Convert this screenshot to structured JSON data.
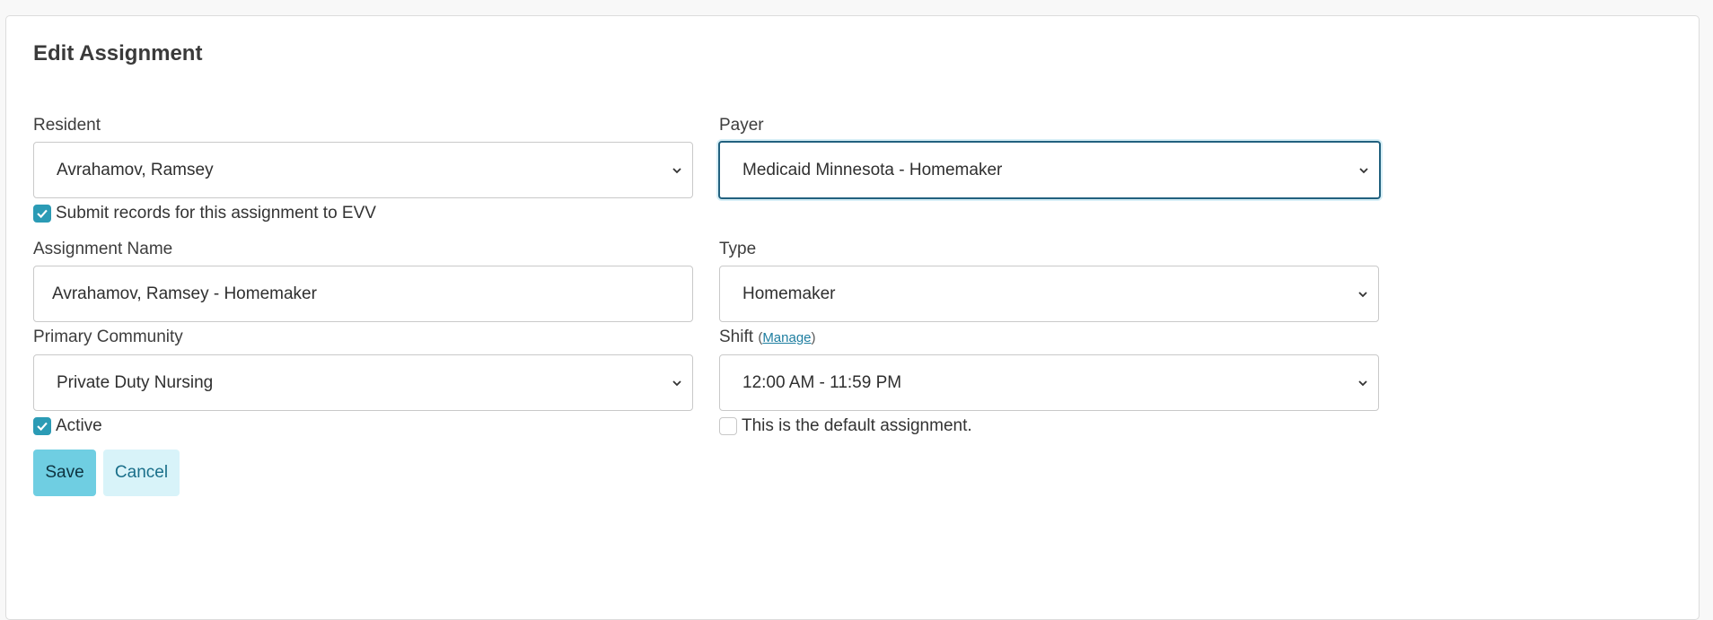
{
  "form": {
    "title": "Edit Assignment",
    "resident": {
      "label": "Resident",
      "value": "Avrahamov, Ramsey"
    },
    "payer": {
      "label": "Payer",
      "value": "Medicaid Minnesota - Homemaker"
    },
    "evv_checkbox": {
      "label": "Submit records for this assignment to EVV",
      "checked": true
    },
    "assignment_name": {
      "label": "Assignment Name",
      "value": "Avrahamov, Ramsey - Homemaker"
    },
    "type": {
      "label": "Type",
      "value": "Homemaker"
    },
    "primary_community": {
      "label": "Primary Community",
      "value": "Private Duty Nursing"
    },
    "shift": {
      "label": "Shift",
      "paren_open": "(",
      "manage_link": "Manage",
      "paren_close": ")",
      "value": "12:00 AM - 11:59 PM"
    },
    "active_checkbox": {
      "label": "Active",
      "checked": true
    },
    "default_checkbox": {
      "label": "This is the default assignment.",
      "checked": false
    },
    "save_label": "Save",
    "cancel_label": "Cancel"
  },
  "colors": {
    "accent": "#2b9bb5",
    "save_button": "#6fcee2",
    "cancel_button": "#d8f3f9",
    "focus_border": "#22617f"
  },
  "icons": {
    "select": "chevron-down-icon",
    "checkbox": "check-icon"
  }
}
